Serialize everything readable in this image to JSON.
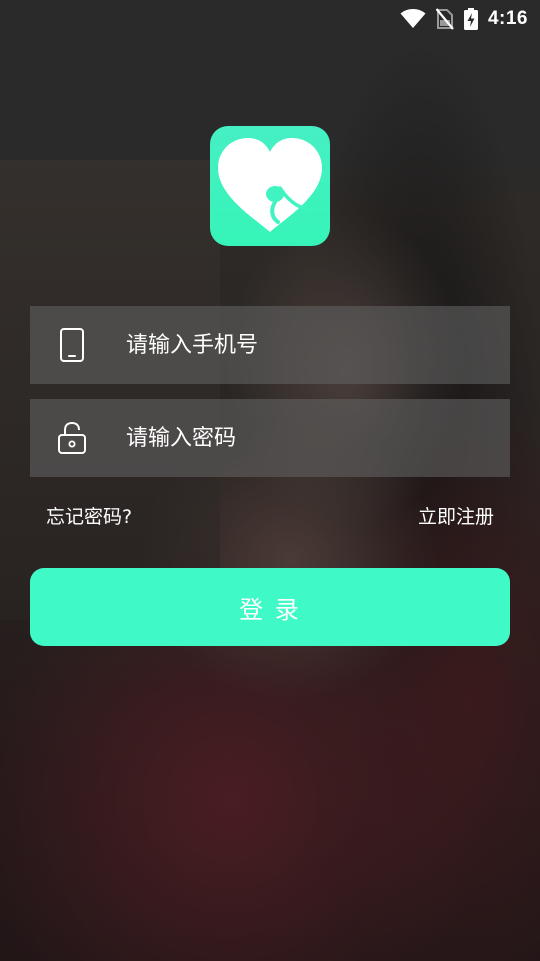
{
  "status_bar": {
    "time": "4:16",
    "icons": [
      "wifi-icon",
      "no-sim-icon",
      "battery-charging-icon"
    ]
  },
  "app": {
    "logo_icon": "heart-sperm-logo",
    "accent_color": "#3ffac6"
  },
  "login_form": {
    "phone": {
      "placeholder": "请输入手机号",
      "value": "",
      "icon": "phone-icon"
    },
    "password": {
      "placeholder": "请输入密码",
      "value": "",
      "icon": "unlock-icon"
    },
    "forgot_label": "忘记密码?",
    "register_label": "立即注册",
    "login_label": "登 录"
  }
}
